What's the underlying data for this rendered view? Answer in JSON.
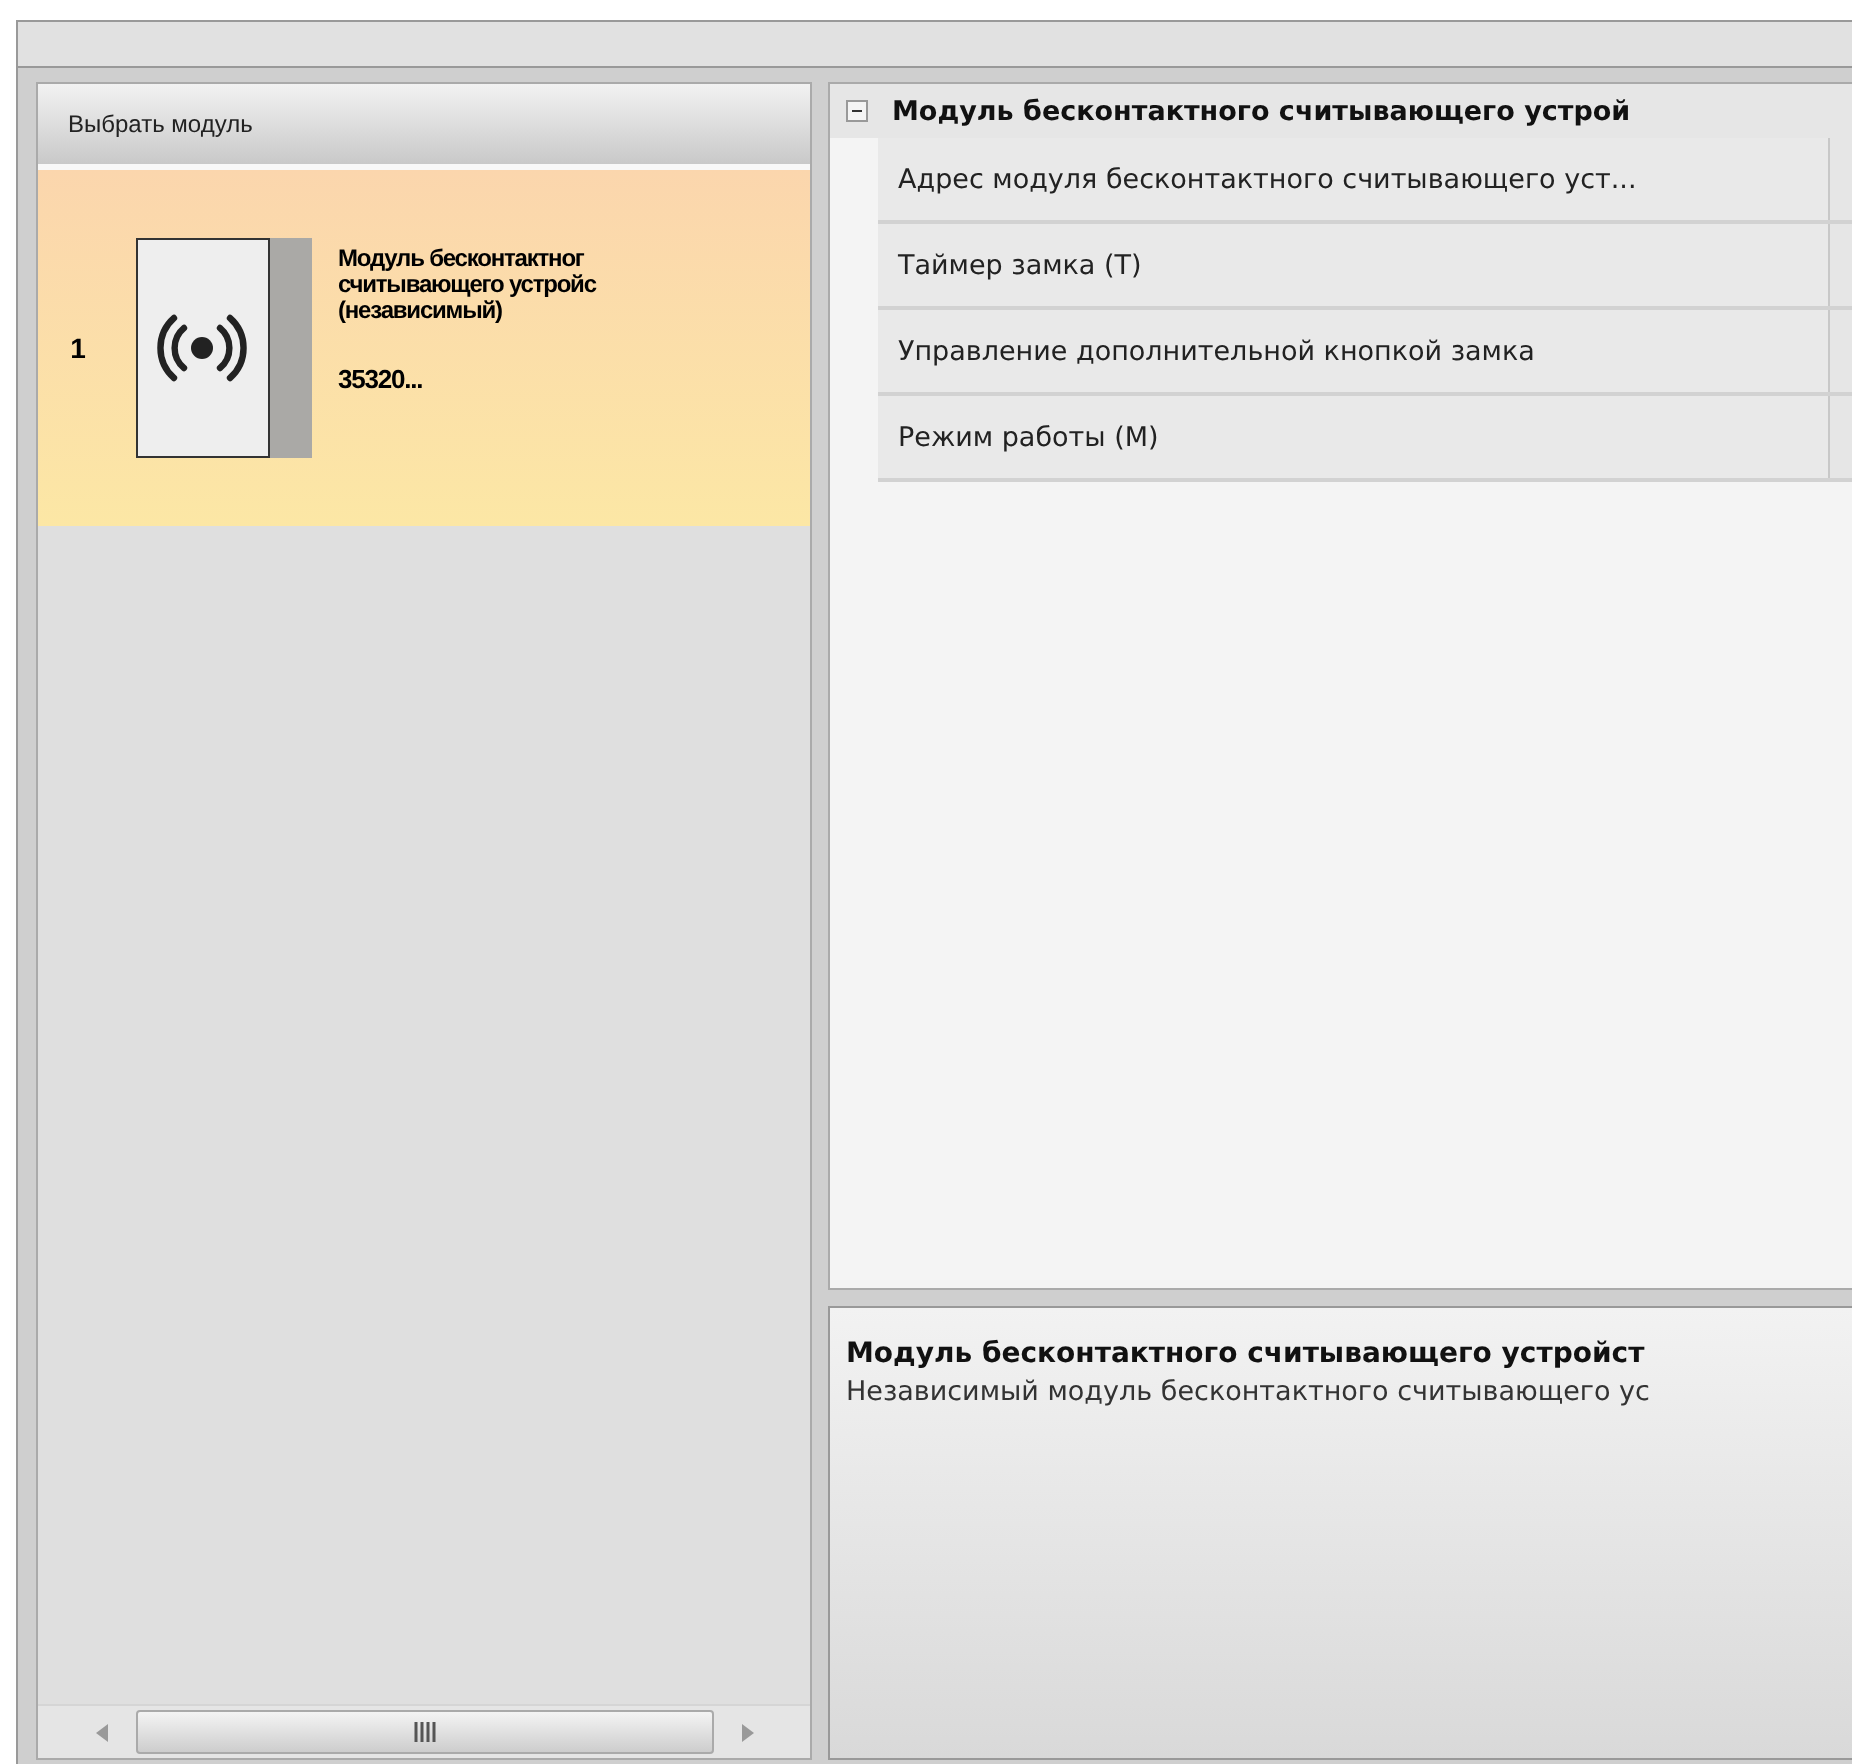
{
  "module_panel": {
    "title": "Выбрать модуль",
    "modules": [
      {
        "number": "1",
        "name_lines": [
          "Модуль бесконтактног",
          "считывающего устройс",
          "(независимый)"
        ],
        "code": "35320...",
        "selected": true
      }
    ]
  },
  "property_grid": {
    "group": {
      "title": "Модуль бесконтактного считывающего устрой",
      "expanded": true,
      "rows": [
        {
          "name": "Адрес модуля бесконтактного считывающего уст..."
        },
        {
          "name": "Таймер замка (Т)"
        },
        {
          "name": "Управление дополнительной кнопкой замка"
        },
        {
          "name": "Режим работы (М)"
        }
      ]
    }
  },
  "description": {
    "title": "Модуль бесконтактного считывающего устройст",
    "text": "Независимый модуль бесконтактного считывающего ус"
  }
}
